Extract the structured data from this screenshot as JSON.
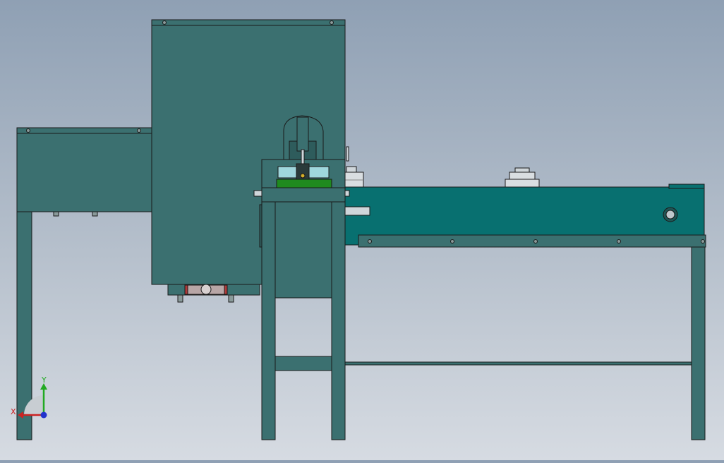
{
  "scene": {
    "colors": {
      "frame": "#3b7070",
      "frame_dark": "#2e5c5c",
      "conveyor": "#087070",
      "outline": "#1a1a1a",
      "green_plate": "#1f8a1f",
      "steel": "#cfd6da"
    }
  },
  "triad": {
    "x_label": "X",
    "y_label": "Y",
    "x_color": "#cc2222",
    "y_color": "#22aa22",
    "z_color": "#2233cc"
  }
}
